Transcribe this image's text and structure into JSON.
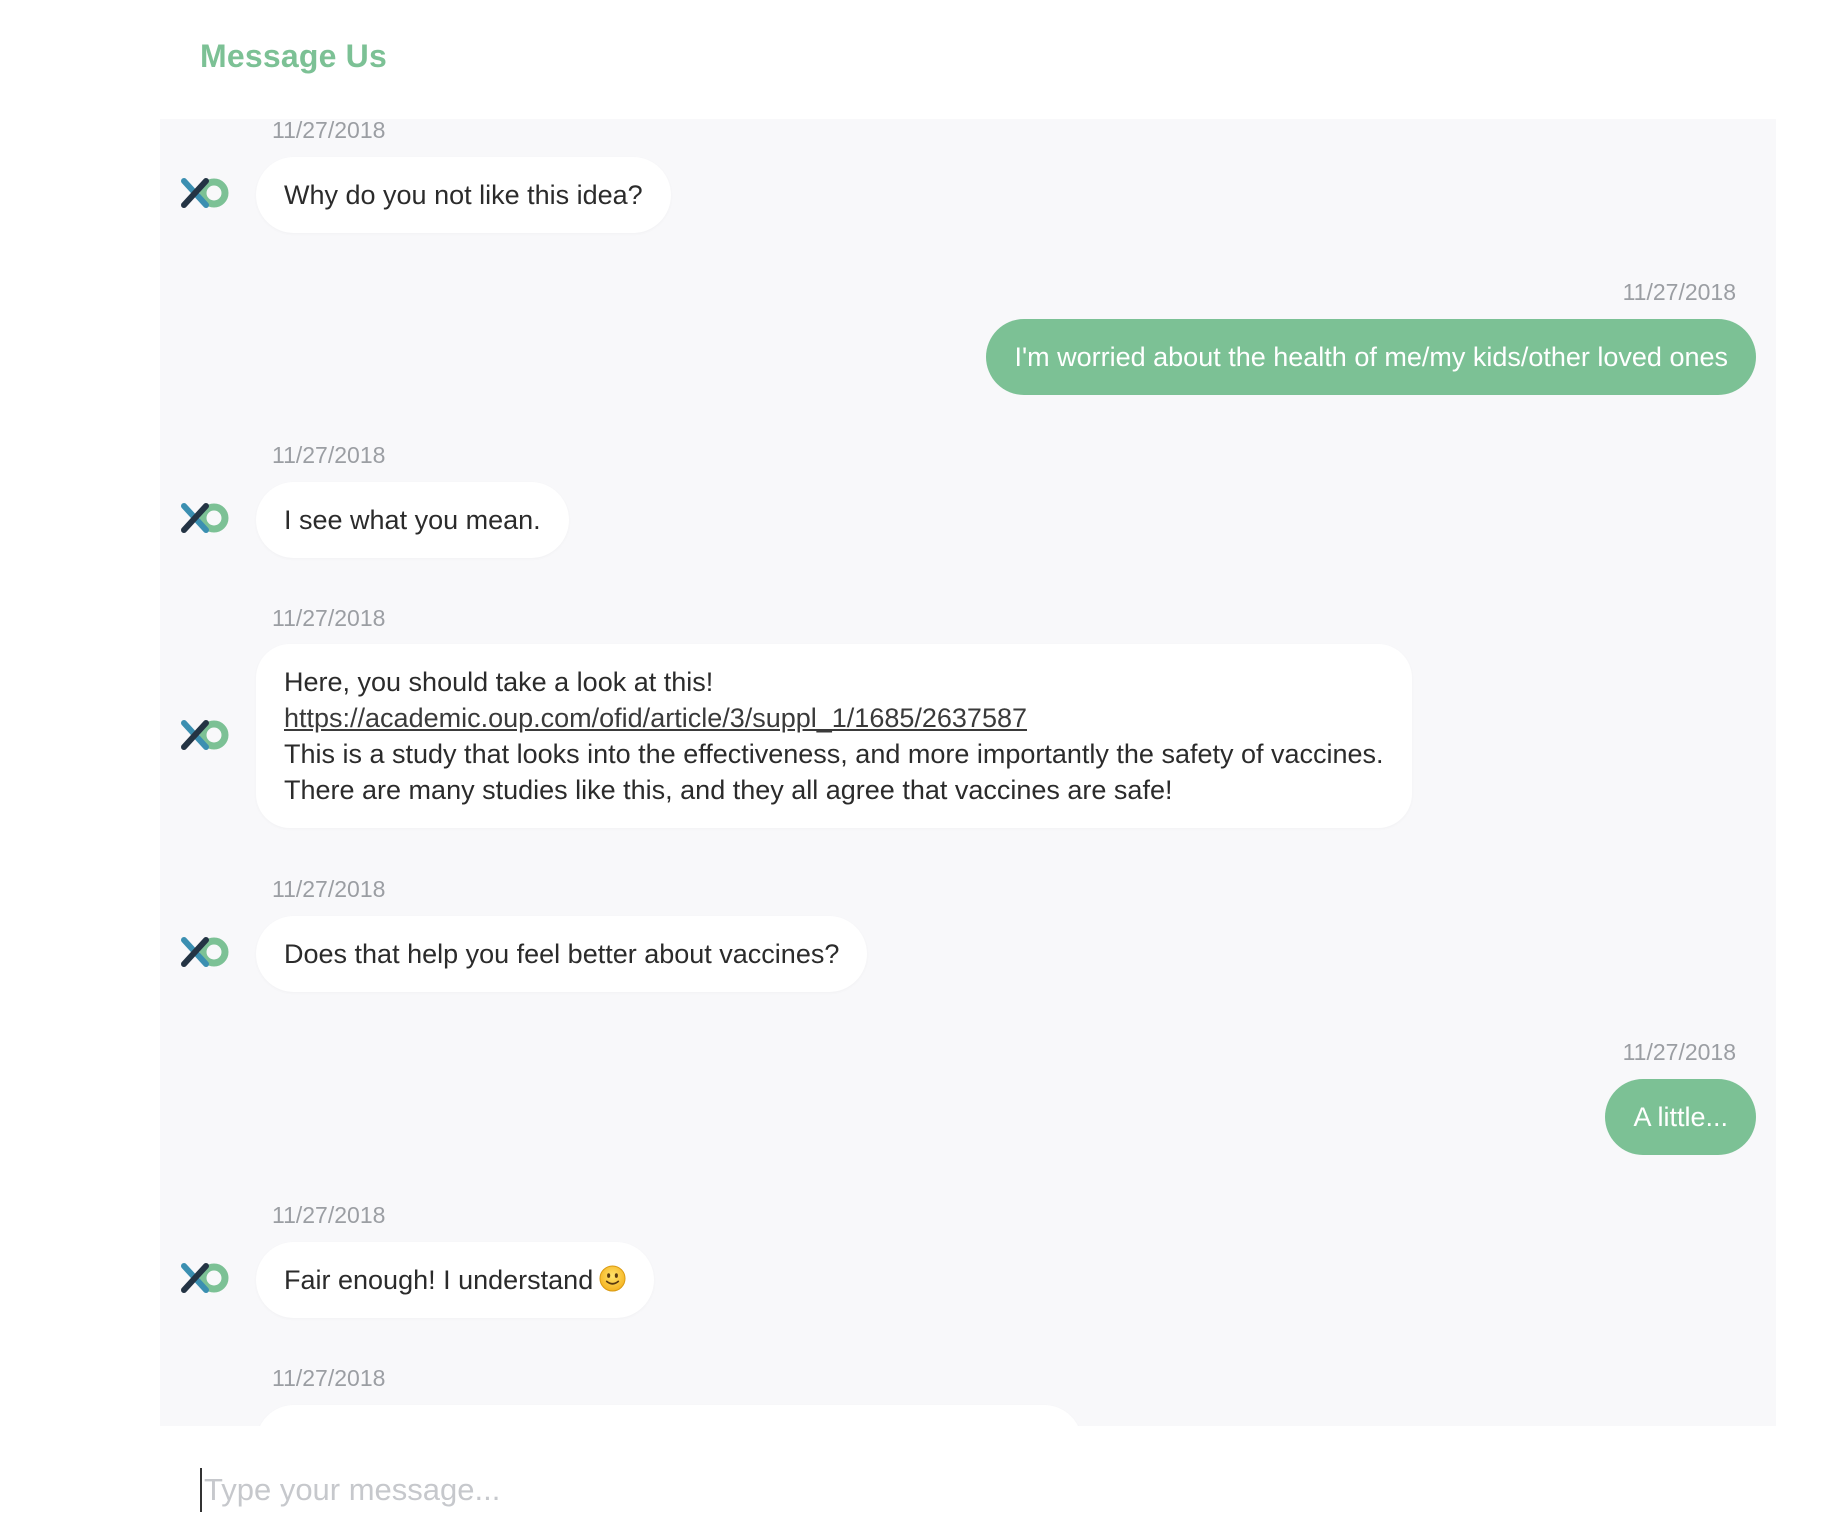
{
  "header": {
    "title": "Message Us"
  },
  "messages": [
    {
      "sender": "bot",
      "timestamp": "11/27/2018",
      "lines": [
        "Why do you not like this idea?"
      ]
    },
    {
      "sender": "user",
      "timestamp": "11/27/2018",
      "lines": [
        "I'm worried about the health of me/my kids/other loved ones"
      ]
    },
    {
      "sender": "bot",
      "timestamp": "11/27/2018",
      "lines": [
        "I see what you mean."
      ]
    },
    {
      "sender": "bot",
      "timestamp": "11/27/2018",
      "lines": [
        "Here, you should take a look at this!",
        "https://academic.oup.com/ofid/article/3/suppl_1/1685/2637587",
        "This is a study that looks into the effectiveness, and more importantly the safety of vaccines.",
        "There are many studies like this, and they all agree that vaccines are safe!"
      ],
      "link_line": 1
    },
    {
      "sender": "bot",
      "timestamp": "11/27/2018",
      "lines": [
        "Does that help you feel better about vaccines?"
      ]
    },
    {
      "sender": "user",
      "timestamp": "11/27/2018",
      "lines": [
        "A little..."
      ]
    },
    {
      "sender": "bot",
      "timestamp": "11/27/2018",
      "lines": [
        "Fair enough! I understand"
      ],
      "emoji": "slightly-smiling-face-icon"
    },
    {
      "sender": "bot",
      "timestamp": "11/27/2018",
      "lines": [
        ""
      ]
    }
  ],
  "composer": {
    "placeholder": "Type your message..."
  },
  "colors": {
    "brand_green": "#7cc195",
    "brand_teal": "#3b8fb1",
    "brand_dark": "#243444",
    "panel_bg": "#f8f8fa",
    "timestamp": "#9b9ea3"
  }
}
